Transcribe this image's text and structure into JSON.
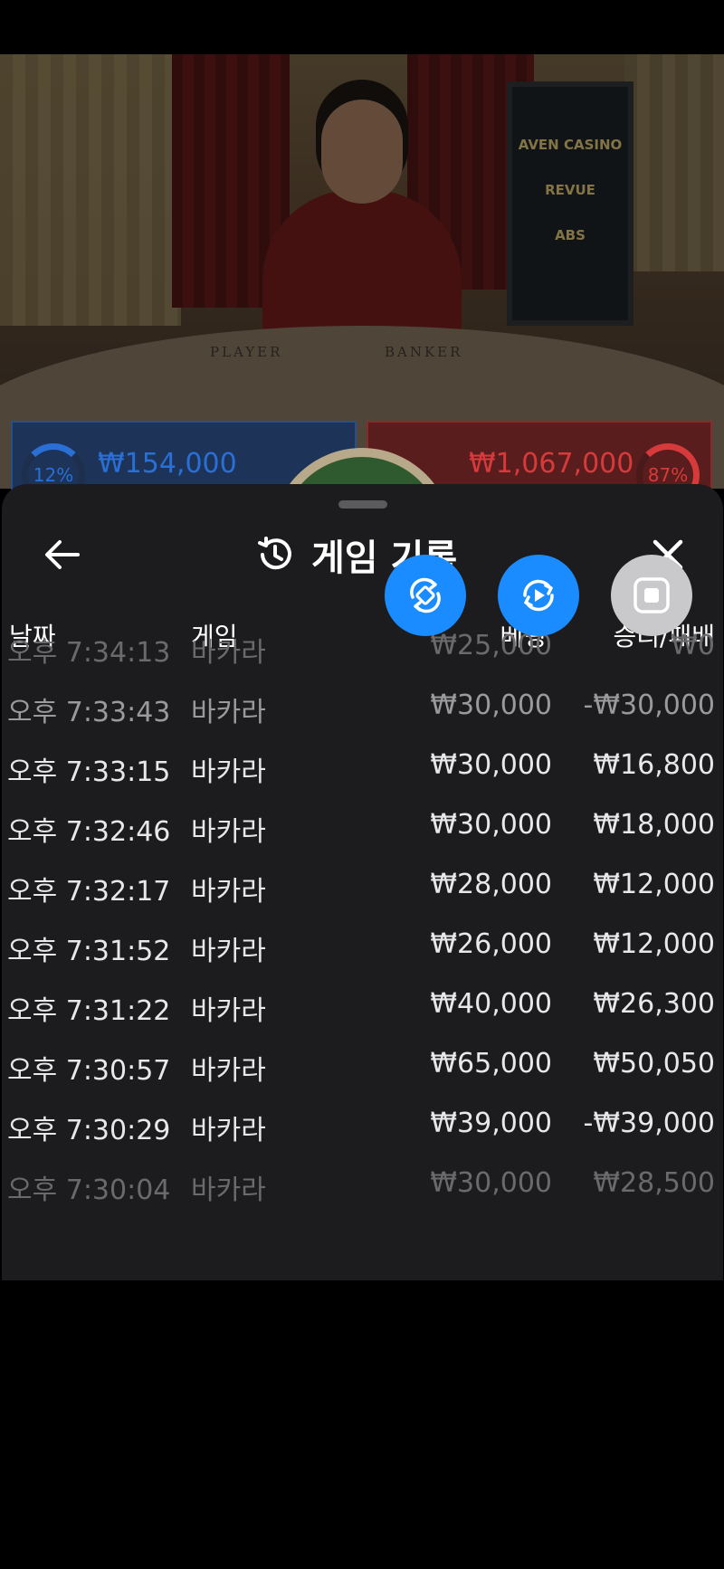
{
  "scene": {
    "table_labels": {
      "player": "PLAYER",
      "banker": "BANKER"
    },
    "sign_board": [
      "AVEN CASINO",
      "REVUE",
      "ABS"
    ]
  },
  "bet_bars": {
    "player": {
      "percent": "12%",
      "amount": "₩154,000",
      "color": "#2a6fd6"
    },
    "banker": {
      "percent": "87%",
      "amount": "₩1,067,000",
      "color": "#d63a3a"
    }
  },
  "sheet": {
    "title": "게임 기록",
    "icons": {
      "back": "arrow-left-icon",
      "history": "history-icon",
      "close": "close-icon"
    }
  },
  "floating_buttons": [
    {
      "name": "rotate-screen-icon",
      "color": "#1a8cff"
    },
    {
      "name": "replay-icon",
      "color": "#1a8cff"
    },
    {
      "name": "stop-record-icon",
      "color": "#c9c9cc"
    }
  ],
  "table": {
    "headers": {
      "date": "날짜",
      "game": "게임",
      "bet": "베팅",
      "result": "승리/패배"
    },
    "rows": [
      {
        "date": "오후 7:34:13",
        "game": "바카라",
        "bet": "₩25,000",
        "result": "₩0"
      },
      {
        "date": "오후 7:33:43",
        "game": "바카라",
        "bet": "₩30,000",
        "result": "-₩30,000"
      },
      {
        "date": "오후 7:33:15",
        "game": "바카라",
        "bet": "₩30,000",
        "result": "₩16,800"
      },
      {
        "date": "오후 7:32:46",
        "game": "바카라",
        "bet": "₩30,000",
        "result": "₩18,000"
      },
      {
        "date": "오후 7:32:17",
        "game": "바카라",
        "bet": "₩28,000",
        "result": "₩12,000"
      },
      {
        "date": "오후 7:31:52",
        "game": "바카라",
        "bet": "₩26,000",
        "result": "₩12,000"
      },
      {
        "date": "오후 7:31:22",
        "game": "바카라",
        "bet": "₩40,000",
        "result": "₩26,300"
      },
      {
        "date": "오후 7:30:57",
        "game": "바카라",
        "bet": "₩65,000",
        "result": "₩50,050"
      },
      {
        "date": "오후 7:30:29",
        "game": "바카라",
        "bet": "₩39,000",
        "result": "-₩39,000"
      },
      {
        "date": "오후 7:30:04",
        "game": "바카라",
        "bet": "₩30,000",
        "result": "₩28,500"
      }
    ]
  }
}
